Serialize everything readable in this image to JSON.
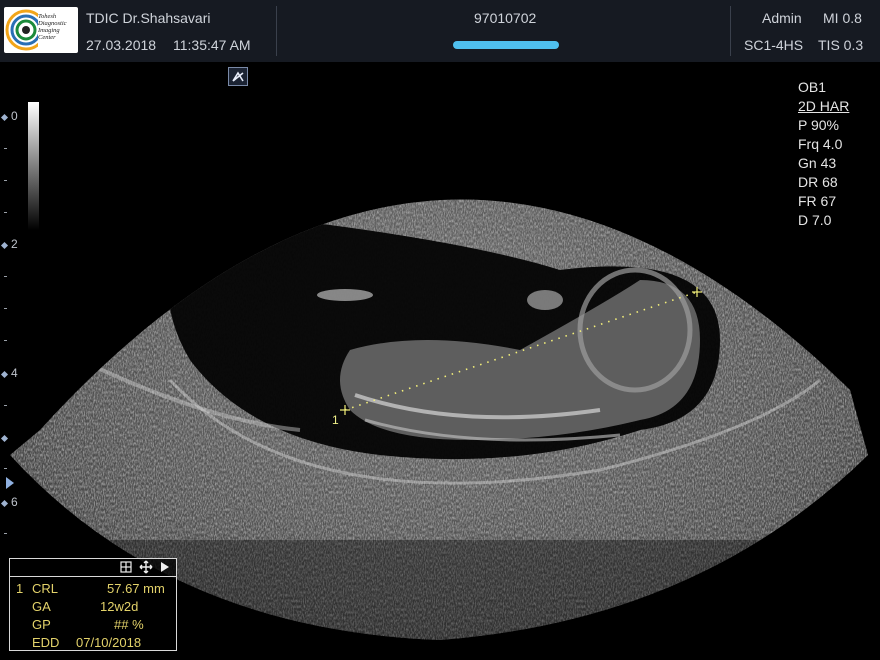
{
  "header": {
    "logo_text": [
      "Tohesh",
      "Diagnostic",
      "Imaging",
      "Center"
    ],
    "clinic": "TDIC Dr.Shahsavari",
    "date": "27.03.2018",
    "time": "11:35:47 AM",
    "patient_id": "97010702",
    "user": "Admin",
    "mi": "MI 0.8",
    "probe": "SC1-4HS",
    "tis": "TIS 0.3"
  },
  "params": {
    "preset": "OB1",
    "mode": "2D HAR",
    "power": "P 90%",
    "freq": "Frq 4.0",
    "gain": "Gn 43",
    "dr": "DR 68",
    "fr": "FR 67",
    "depth": "D 7.0"
  },
  "depth_scale": {
    "labels": [
      "0",
      "2",
      "4",
      "6"
    ]
  },
  "caliper": {
    "index": "1"
  },
  "measurements": {
    "index": "1",
    "rows": [
      {
        "label": "CRL",
        "value": "57.67 mm"
      },
      {
        "label": "GA",
        "value": "12w2d"
      },
      {
        "label": "GP",
        "value": "## %"
      },
      {
        "label": "EDD",
        "value": "07/10/2018"
      }
    ]
  },
  "icons": {
    "toolbar": [
      "grid-icon",
      "move-icon",
      "play-icon"
    ],
    "caret": "caret-icon"
  }
}
